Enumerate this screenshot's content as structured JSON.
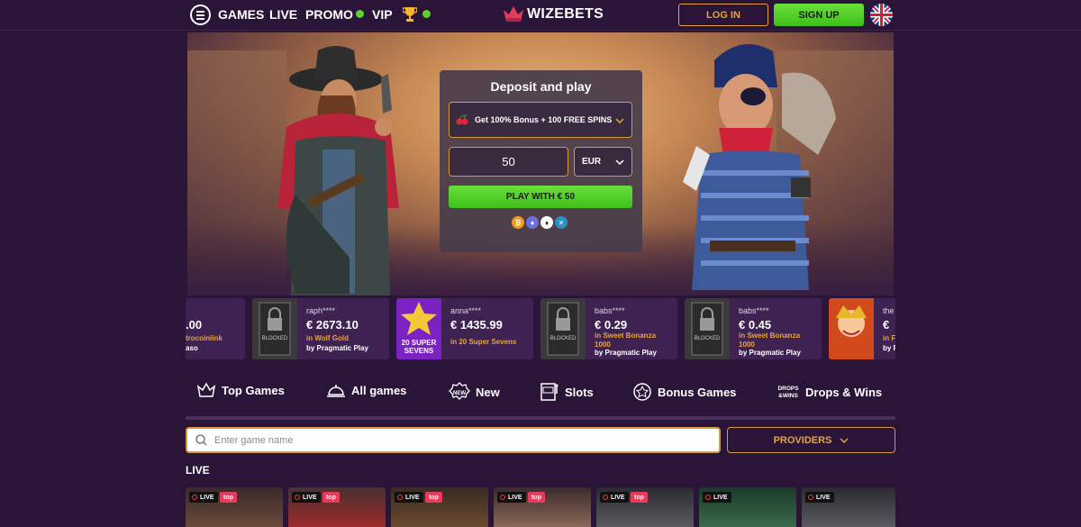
{
  "header": {
    "nav": [
      {
        "label": "GAMES"
      },
      {
        "label": "LIVE"
      },
      {
        "label": "PROMO",
        "badge": "0"
      },
      {
        "label": "VIP"
      }
    ],
    "trophy_badge": "0",
    "logo_text": "WIZEBETS",
    "login_label": "LOG IN",
    "signup_label": "SIGN UP",
    "accent_color": "#e8a33c",
    "green_color": "#4ccc22"
  },
  "deposit": {
    "title": "Deposit and play",
    "bonus_text": "Get 100% Bonus + 100 FREE SPINS",
    "amount": "50",
    "currency": "EUR",
    "play_label": "PLAY WITH € 50",
    "crypto_icons": [
      "bitcoin-icon",
      "ethereum-icon",
      "ethereum-classic-icon",
      "ripple-icon"
    ]
  },
  "wins": [
    {
      "user": "",
      "amount": ".00",
      "game": "trocoinlink",
      "provider": "aso"
    },
    {
      "user": "raph****",
      "amount": "€ 2673.10",
      "game": "in Wolf Gold",
      "provider": "by Pragmatic Play",
      "thumb": "BLOCKED"
    },
    {
      "user": "anna****",
      "amount": "€ 1435.99",
      "game": "in 20 Super Sevens",
      "provider": "",
      "thumb": "20 SUPER SEVENS"
    },
    {
      "user": "babs****",
      "amount": "€ 0.29",
      "game": "in Sweet Bonanza 1000",
      "provider": "by Pragmatic Play",
      "thumb": "BLOCKED"
    },
    {
      "user": "babs****",
      "amount": "€ 0.45",
      "game": "in Sweet Bonanza 1000",
      "provider": "by Pragmatic Play",
      "thumb": "BLOCKED"
    },
    {
      "user": "the",
      "amount": "€",
      "game": "in F",
      "provider": "by F"
    }
  ],
  "categories": [
    {
      "label": "Top Games",
      "icon": "crown-icon"
    },
    {
      "label": "All games",
      "icon": "cloche-icon"
    },
    {
      "label": "New",
      "icon": "new-badge-icon"
    },
    {
      "label": "Slots",
      "icon": "slot-machine-icon"
    },
    {
      "label": "Bonus Games",
      "icon": "bonus-star-icon"
    },
    {
      "label": "Drops & Wins",
      "icon": "drops-wins-icon"
    }
  ],
  "search": {
    "placeholder": "Enter game name"
  },
  "providers_label": "PROVIDERS",
  "live_section": {
    "title": "LIVE",
    "cards": [
      {
        "live": "LIVE",
        "top": "top"
      },
      {
        "live": "LIVE",
        "top": "top"
      },
      {
        "live": "LIVE",
        "top": "top"
      },
      {
        "live": "LIVE",
        "top": "top"
      },
      {
        "live": "LIVE",
        "top": "top"
      },
      {
        "live": "LIVE",
        "top": ""
      },
      {
        "live": "LIVE",
        "top": ""
      }
    ]
  }
}
